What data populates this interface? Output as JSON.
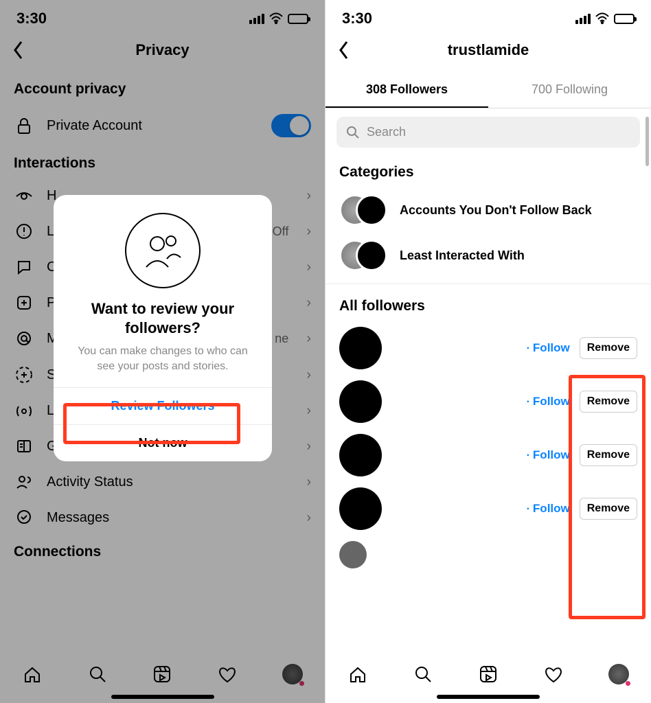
{
  "status": {
    "time": "3:30"
  },
  "left": {
    "title": "Privacy",
    "section1": "Account privacy",
    "private_label": "Private Account",
    "section2": "Interactions",
    "section3": "Connections",
    "rows": [
      {
        "label": "H",
        "chev": true
      },
      {
        "label": "L",
        "val": "Off",
        "chev": true
      },
      {
        "label": "C",
        "chev": true
      },
      {
        "label": "P",
        "chev": true
      },
      {
        "label": "M",
        "val": "ne",
        "chev": true
      },
      {
        "label": "S",
        "chev": true
      },
      {
        "label": "L",
        "chev": true
      },
      {
        "label": "G",
        "chev": true
      },
      {
        "label": "Activity Status",
        "chev": true
      },
      {
        "label": "Messages",
        "chev": true
      }
    ],
    "modal": {
      "title": "Want to review your followers?",
      "sub": "You can make changes to who can see your posts and stories.",
      "primary": "Review Followers",
      "secondary": "Not now"
    }
  },
  "right": {
    "title": "trustlamide",
    "tab1": "308 Followers",
    "tab2": "700 Following",
    "search_placeholder": "Search",
    "categories_label": "Categories",
    "cat1": "Accounts You Don't Follow Back",
    "cat2": "Least Interacted With",
    "all_label": "All followers",
    "follow_label": "Follow",
    "remove_label": "Remove"
  }
}
